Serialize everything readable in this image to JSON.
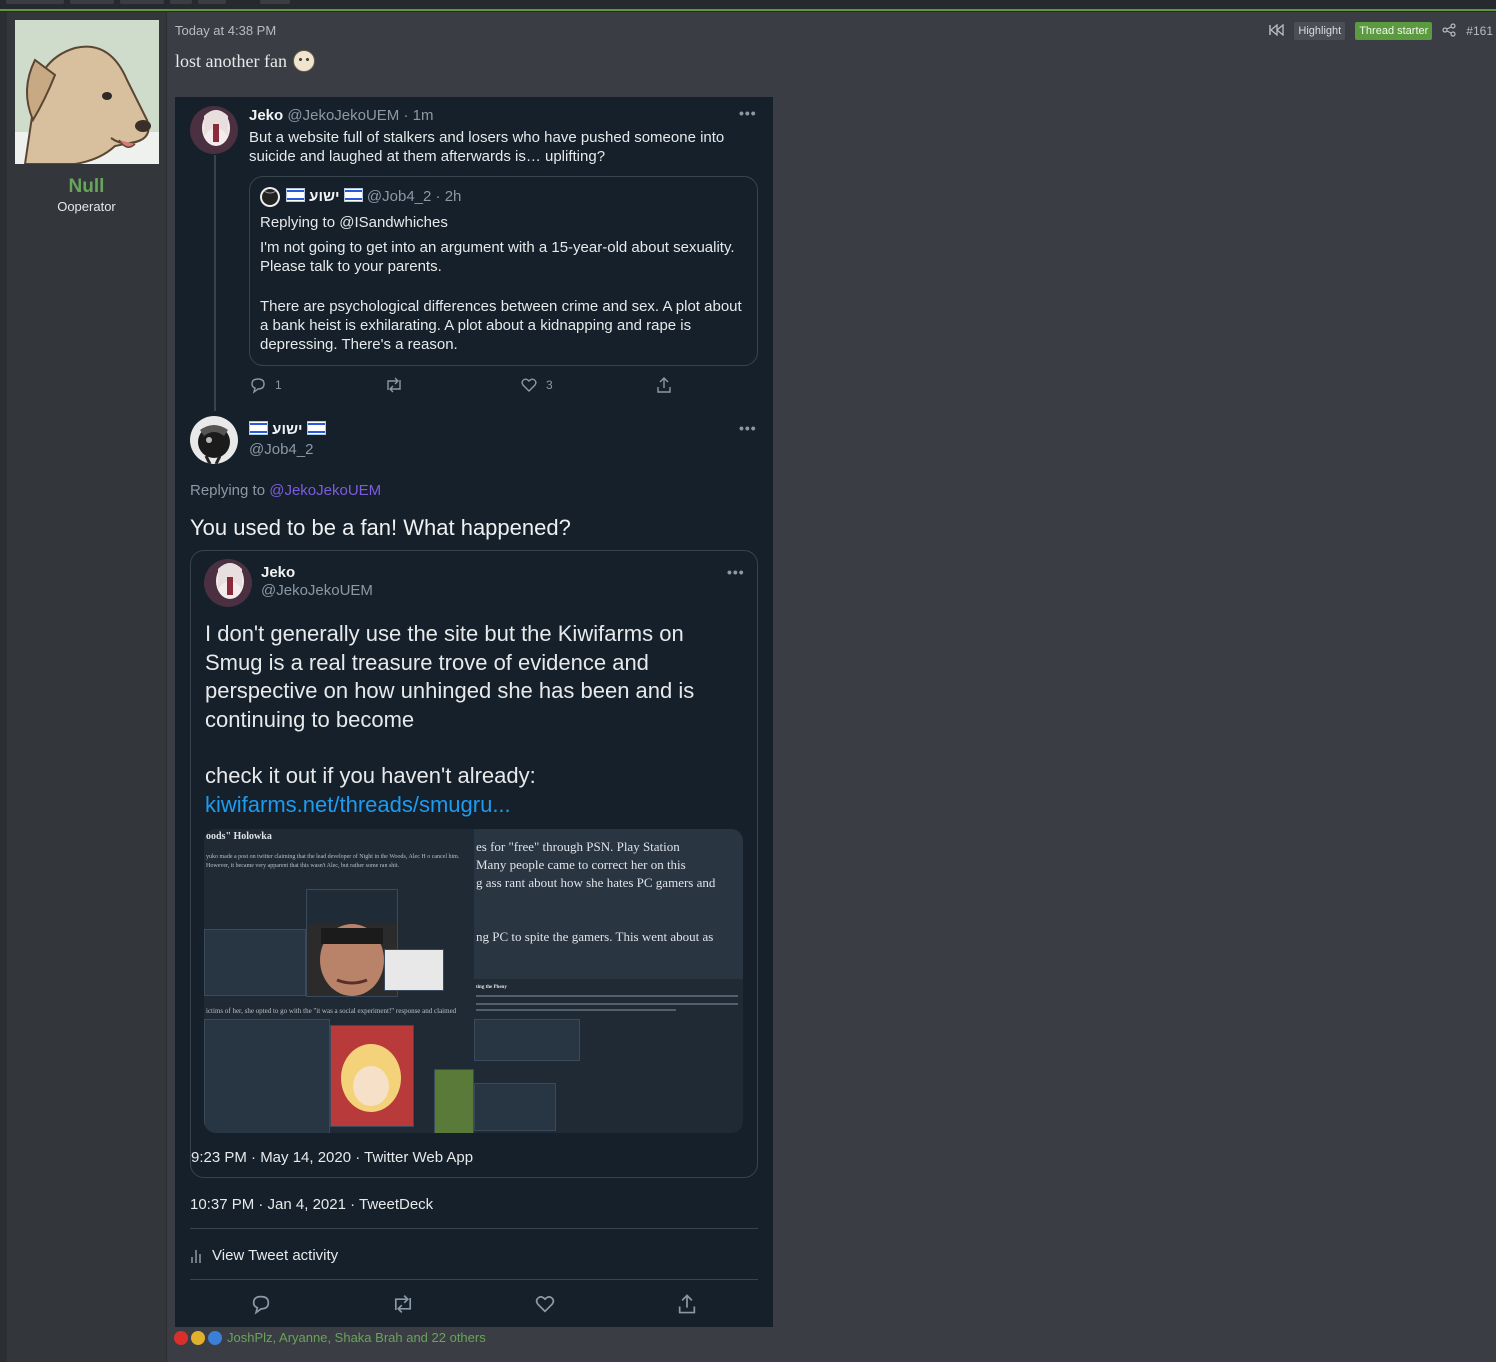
{
  "post": {
    "date": "Today at 4:38 PM",
    "highlight_label": "Highlight",
    "thread_starter_label": "Thread starter",
    "post_number": "#161",
    "body_text": "lost another fan"
  },
  "user": {
    "name": "Null",
    "title": "Ooperator"
  },
  "tweet1": {
    "name": "Jeko",
    "handle": "@JekoJekoUEM · 1m",
    "text": "But a website full of stalkers and losers who have pushed someone into suicide and laughed at them afterwards is… uplifting?",
    "quote": {
      "name": "ישוע",
      "handle": "@Job4_2 · 2h",
      "replying_to": "Replying to @ISandwhiches",
      "text1": "I'm not going to get into an argument with a 15-year-old about sexuality. Please talk to your parents.",
      "text2": "There are psychological differences between crime and sex. A plot about a bank heist is exhilarating. A plot about a kidnapping and rape is depressing. There's a reason."
    },
    "reply_count": "1",
    "like_count": "3"
  },
  "tweet2": {
    "name": "ישוע",
    "handle": "@Job4_2",
    "replying_prefix": "Replying to ",
    "replying_handle": "@JekoJekoUEM",
    "text": "You used to be a fan! What happened?",
    "embedded": {
      "name": "Jeko",
      "handle": "@JekoJekoUEM",
      "text": "I don't generally use the site but the Kiwifarms on Smug is a real treasure trove of evidence and perspective on how unhinged she has been and is continuing to become",
      "text2": "check it out if you haven't already:",
      "link": "kiwifarms.net/threads/smugru...",
      "meta": "9:23 PM · May 14, 2020 · Twitter Web App",
      "collage": {
        "left_title": "oods\" Holowka",
        "left_body": "yuko made a post on twitter claiming that the lead developer of Night in the Woods, Alec H o cancel him. However, it became very apparent that this wasn't Alec, but rather some ran shit.",
        "left_caption": "ictims of her, she opted to go with the \"it was a social experiment!\" response and claimed",
        "right_line1": "es for \"free\" through PSN. Play Station",
        "right_line2": "Many people came to correct her on this",
        "right_line3": "g ass rant about how she hates PC gamers and",
        "right_line4": "ng PC to spite the gamers. This went about as",
        "right_caption": "ting the Pheny"
      }
    },
    "meta": "10:37 PM · Jan 4, 2021 · TweetDeck",
    "activity_label": "View Tweet activity"
  },
  "reactions": {
    "names": "JoshPlz, Aryanne, Shaka Brah",
    "others": " and 22 others"
  },
  "colors": {
    "accent_green": "#5e9a3c",
    "username_green": "#68a45a",
    "tweet_bg": "#15202b",
    "twitter_link": "#1d9bf0"
  }
}
